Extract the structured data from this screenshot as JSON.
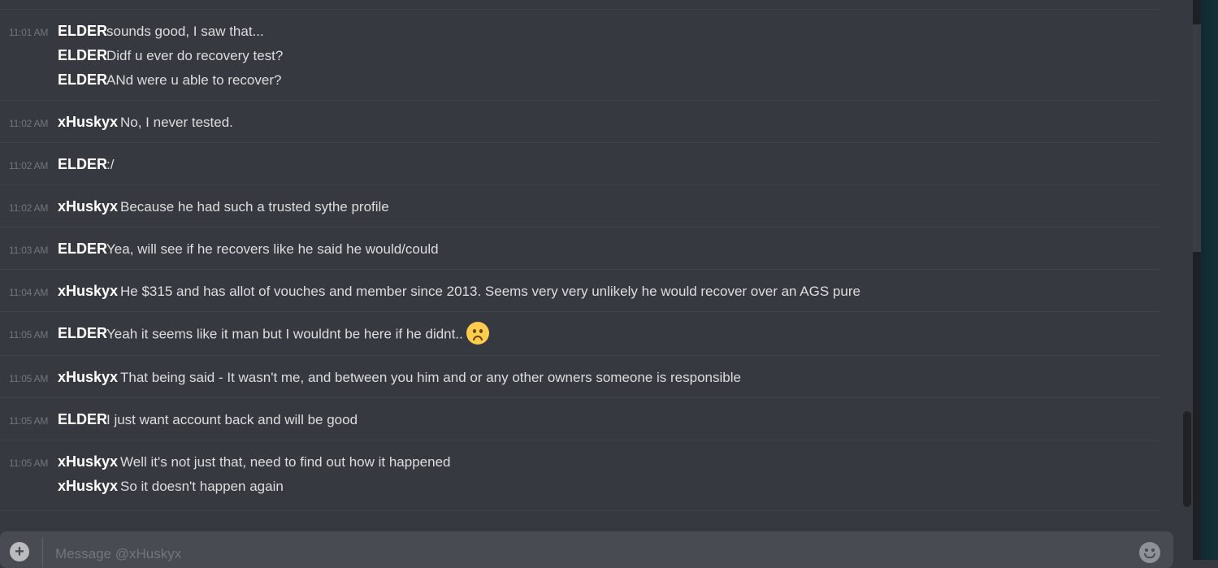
{
  "colors": {
    "background": "#36393f",
    "divider": "#40434a",
    "timestamp": "#72767d",
    "username": "#ffffff",
    "message_text": "#dcddde",
    "composer_bg": "#484b51"
  },
  "groups": [
    {
      "timestamp": "11:01 AM",
      "lines": [
        {
          "user": "ELDER",
          "text": "sounds good, I saw that..."
        },
        {
          "user": "ELDER",
          "text": "Didf u ever do recovery test?"
        },
        {
          "user": "ELDER",
          "text": "ANd were u able to recover?"
        }
      ]
    },
    {
      "timestamp": "11:02 AM",
      "lines": [
        {
          "user": "xHuskyx",
          "text": "No, I never tested."
        }
      ]
    },
    {
      "timestamp": "11:02 AM",
      "lines": [
        {
          "user": "ELDER",
          "text": ":/"
        }
      ]
    },
    {
      "timestamp": "11:02 AM",
      "lines": [
        {
          "user": "xHuskyx",
          "text": "Because he had such a trusted sythe profile"
        }
      ]
    },
    {
      "timestamp": "11:03 AM",
      "lines": [
        {
          "user": "ELDER",
          "text": "Yea, will see if he recovers like he said he would/could"
        }
      ]
    },
    {
      "timestamp": "11:04 AM",
      "lines": [
        {
          "user": "xHuskyx",
          "text": "He $315 and has allot of vouches and member since 2013. Seems very very unlikely he would recover over an AGS pure"
        }
      ]
    },
    {
      "timestamp": "11:05 AM",
      "lines": [
        {
          "user": "ELDER",
          "text": "Yeah it seems like it man but I wouldnt be here if he didnt..",
          "emoji": "frowning-face-emoji"
        }
      ]
    },
    {
      "timestamp": "11:05 AM",
      "lines": [
        {
          "user": "xHuskyx",
          "text": "That being said - It wasn't me, and between you him and or any other owners someone is responsible"
        }
      ]
    },
    {
      "timestamp": "11:05 AM",
      "lines": [
        {
          "user": "ELDER",
          "text": "I just want account back and will be good"
        }
      ]
    },
    {
      "timestamp": "11:05 AM",
      "lines": [
        {
          "user": "xHuskyx",
          "text": "Well it's not just that, need to find out how it happened"
        },
        {
          "user": "xHuskyx",
          "text": "So it doesn't happen again"
        }
      ]
    }
  ],
  "composer": {
    "placeholder": "Message @xHuskyx",
    "add_icon": "plus-circle-icon",
    "emoji_icon": "smiley-icon"
  }
}
